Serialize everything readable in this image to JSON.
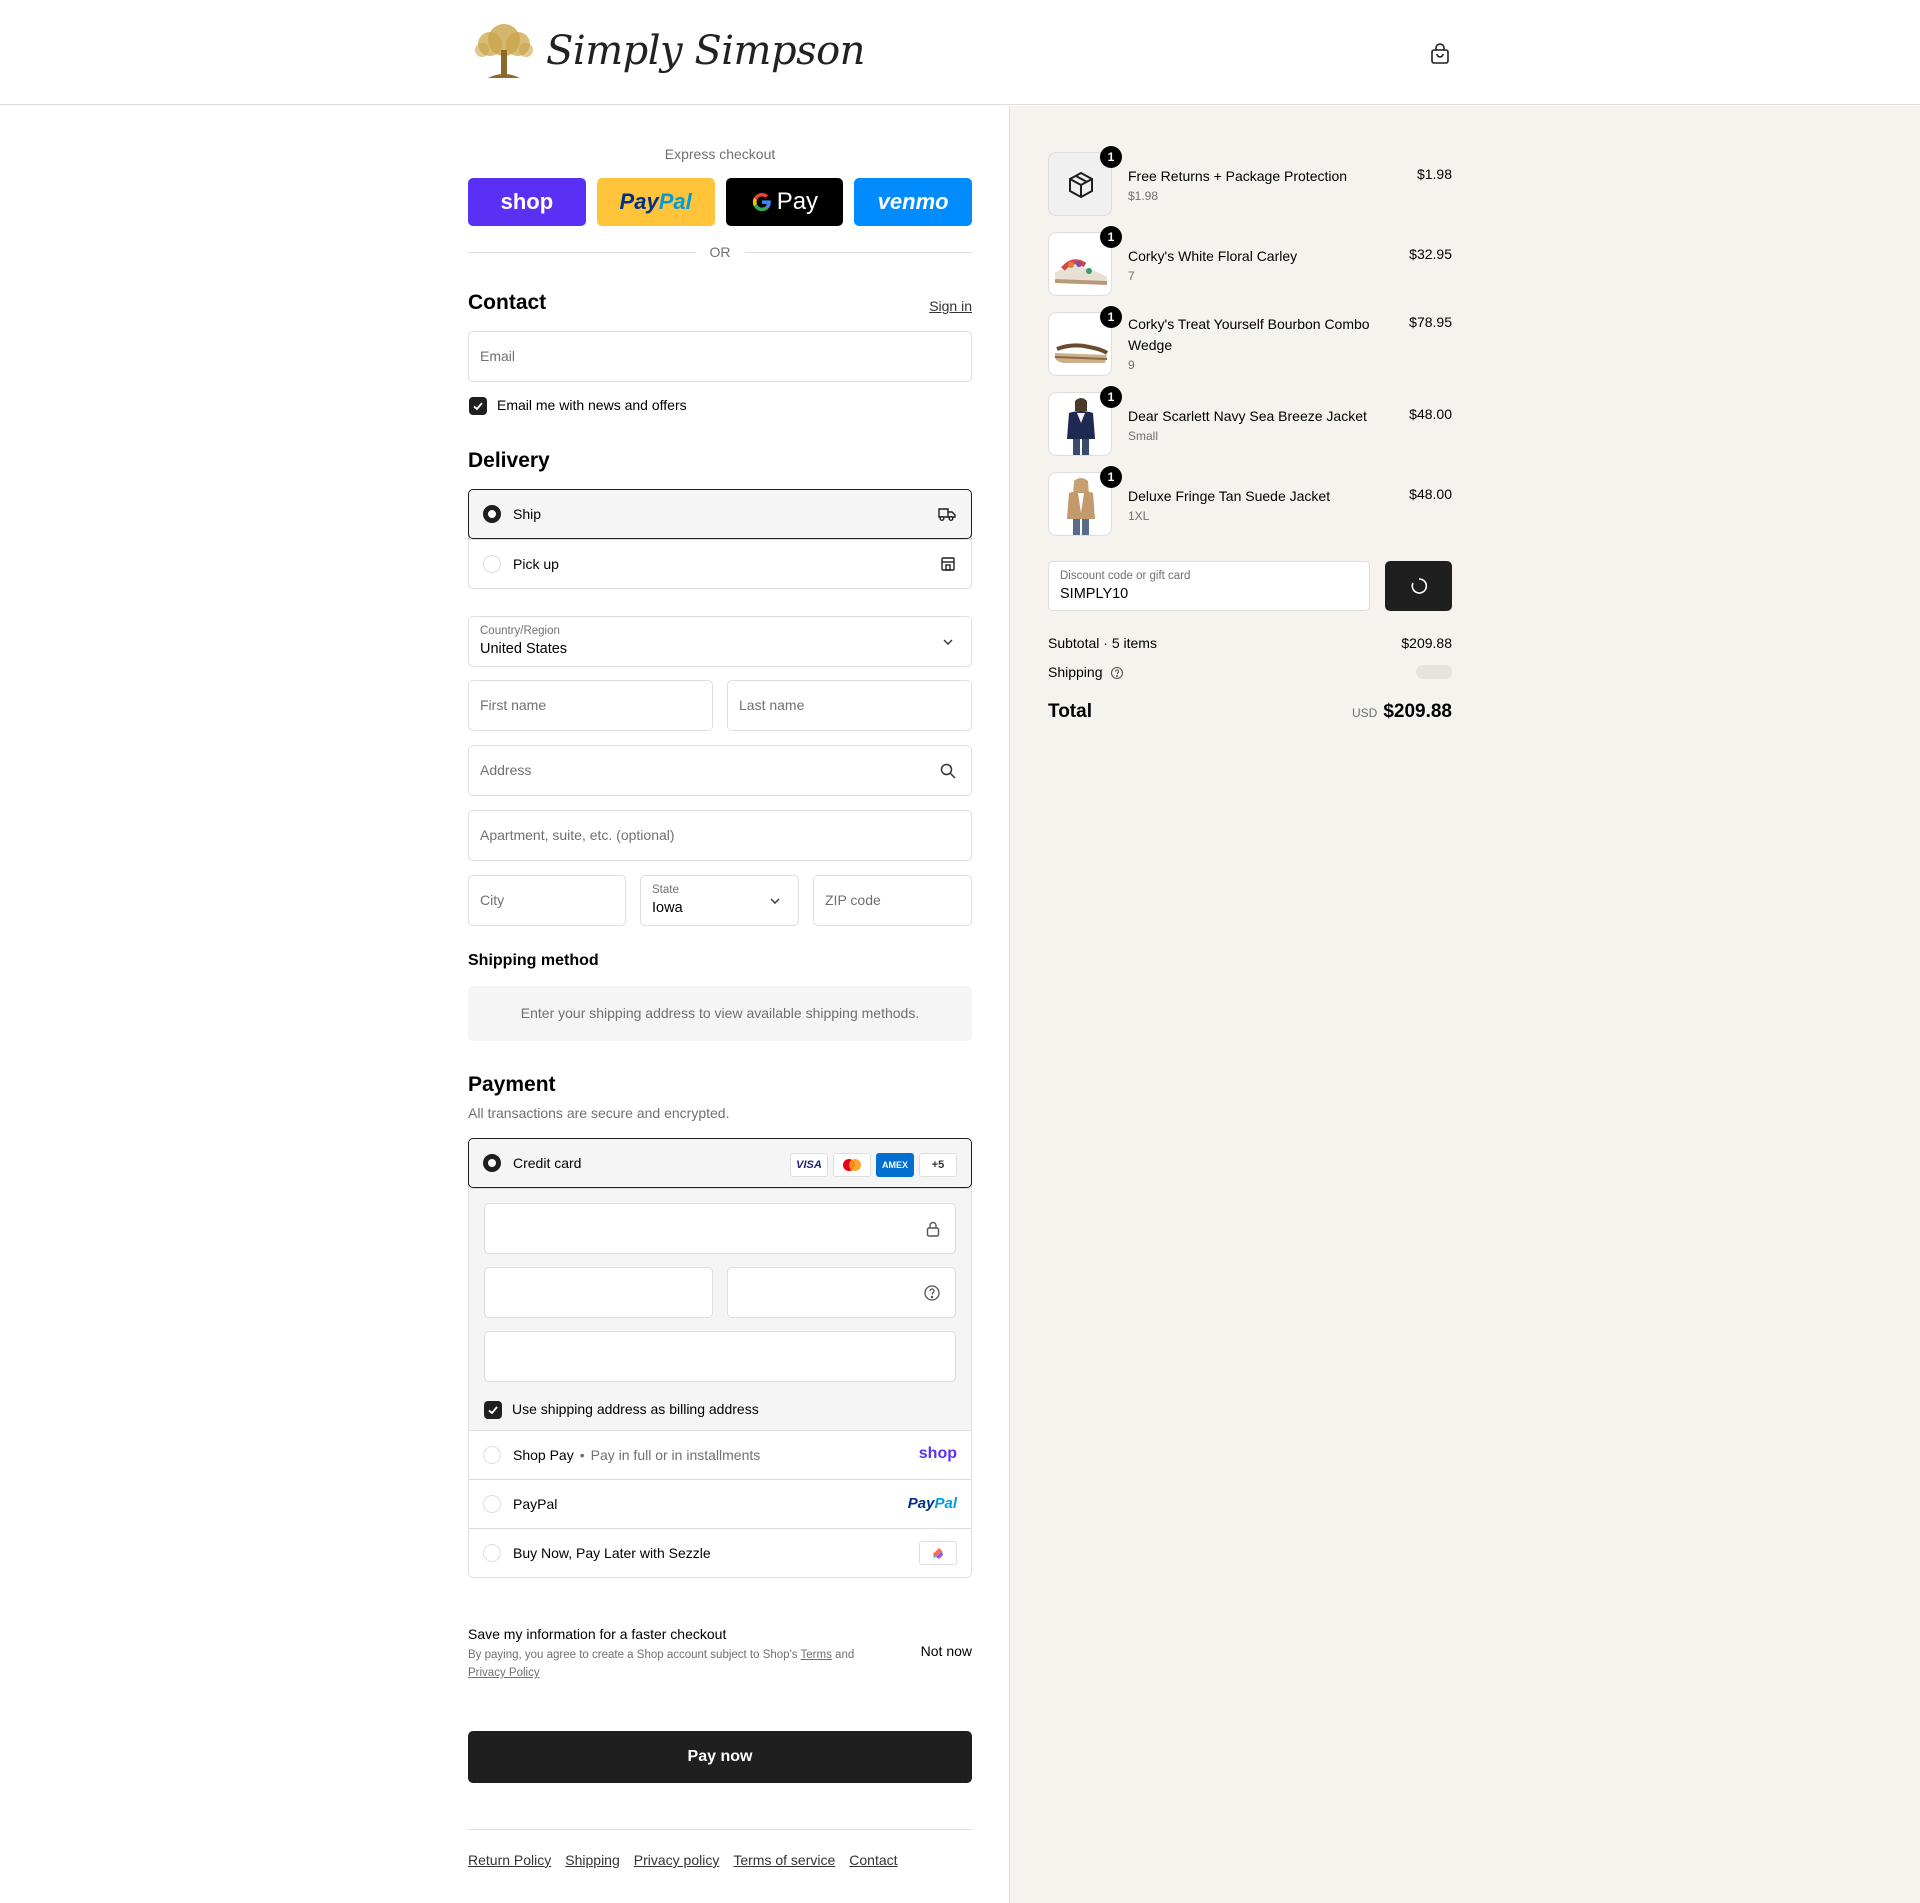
{
  "header": {
    "brand": "Simply Simpson"
  },
  "express": {
    "title": "Express checkout",
    "buttons": {
      "shop": "shop",
      "paypal_a": "Pay",
      "paypal_b": "Pal",
      "gpay": "Pay",
      "venmo": "venmo"
    },
    "or": "OR"
  },
  "contact": {
    "title": "Contact",
    "sign_in": "Sign in",
    "email_placeholder": "Email",
    "news_label": "Email me with news and offers"
  },
  "delivery": {
    "title": "Delivery",
    "options": [
      "Ship",
      "Pick up"
    ],
    "country_label": "Country/Region",
    "country_value": "United States",
    "first_name": "First name",
    "last_name": "Last name",
    "address": "Address",
    "apartment": "Apartment, suite, etc. (optional)",
    "city": "City",
    "state_label": "State",
    "state_value": "Iowa",
    "zip": "ZIP code"
  },
  "shipping_method": {
    "title": "Shipping method",
    "message": "Enter your shipping address to view available shipping methods."
  },
  "payment": {
    "title": "Payment",
    "subtitle": "All transactions are secure and encrypted.",
    "credit_card": "Credit card",
    "badges": {
      "visa": "VISA",
      "amex": "AMEX",
      "more": "+5"
    },
    "billing_label": "Use shipping address as billing address",
    "shop_pay": "Shop Pay",
    "shop_pay_sub": "Pay in full or in installments",
    "shop_logo": "shop",
    "paypal": "PayPal",
    "paypal_logo_a": "Pay",
    "paypal_logo_b": "Pal",
    "sezzle": "Buy Now, Pay Later with Sezzle"
  },
  "save_info": {
    "title": "Save my information for a faster checkout",
    "text_a": "By paying, you agree to create a Shop account subject to Shop's",
    "terms": "Terms",
    "and": "and",
    "privacy": "Privacy Policy",
    "not_now": "Not now"
  },
  "pay_now": "Pay now",
  "footer": [
    "Return Policy",
    "Shipping",
    "Privacy policy",
    "Terms of service",
    "Contact"
  ],
  "summary": {
    "items": [
      {
        "name": "Free Returns + Package Protection",
        "variant": "$1.98",
        "price": "$1.98",
        "qty": "1"
      },
      {
        "name": "Corky's White Floral Carley",
        "variant": "7",
        "price": "$32.95",
        "qty": "1"
      },
      {
        "name": "Corky's Treat Yourself Bourbon Combo Wedge",
        "variant": "9",
        "price": "$78.95",
        "qty": "1"
      },
      {
        "name": "Dear Scarlett Navy Sea Breeze Jacket",
        "variant": "Small",
        "price": "$48.00",
        "qty": "1"
      },
      {
        "name": "Deluxe Fringe Tan Suede Jacket",
        "variant": "1XL",
        "price": "$48.00",
        "qty": "1"
      }
    ],
    "discount_label": "Discount code or gift card",
    "discount_value": "SIMPLY10",
    "subtotal_label": "Subtotal · 5 items",
    "subtotal_value": "$209.88",
    "shipping_label": "Shipping",
    "total_label": "Total",
    "currency": "USD",
    "total_value": "$209.88"
  }
}
